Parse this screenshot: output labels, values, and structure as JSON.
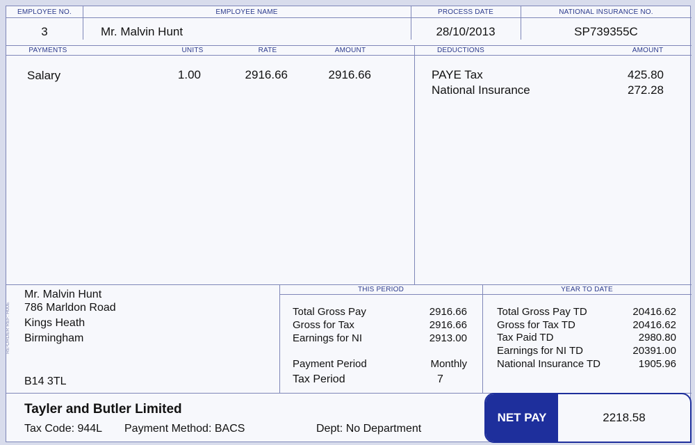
{
  "headers": {
    "employee_no": "EMPLOYEE No.",
    "employee_name": "EMPLOYEE NAME",
    "process_date": "PROCESS DATE",
    "ni_number": "NATIONAL INSURANCE No.",
    "payments": "PAYMENTS",
    "units": "UNITS",
    "rate": "RATE",
    "amount": "AMOUNT",
    "deductions": "DEDUCTIONS",
    "deductions_amount": "AMOUNT",
    "this_period": "THIS PERIOD",
    "year_to_date": "YEAR TO DATE"
  },
  "employee": {
    "number": "3",
    "name": "Mr. Malvin Hunt",
    "process_date": "28/10/2013",
    "ni_number": "SP739355C"
  },
  "payments": [
    {
      "label": "Salary",
      "units": "1.00",
      "rate": "2916.66",
      "amount": "2916.66"
    }
  ],
  "deductions": [
    {
      "label": "PAYE Tax",
      "amount": "425.80"
    },
    {
      "label": "National Insurance",
      "amount": "272.28"
    }
  ],
  "address": {
    "line1": "Mr. Malvin Hunt",
    "line2": "786 Marldon Road",
    "line3": "Kings Heath",
    "line4": "Birmingham",
    "postcode": "B14 3TL"
  },
  "this_period": {
    "rows": [
      {
        "label": "Total Gross Pay",
        "value": "2916.66"
      },
      {
        "label": "Gross for Tax",
        "value": "2916.66"
      },
      {
        "label": "Earnings for NI",
        "value": "2913.00"
      }
    ],
    "payment_period_label": "Payment Period",
    "payment_period_value": "Monthly",
    "tax_period_label": "Tax Period",
    "tax_period_value": "7"
  },
  "year_to_date": {
    "rows": [
      {
        "label": "Total Gross Pay TD",
        "value": "20416.62"
      },
      {
        "label": "Gross for Tax TD",
        "value": "20416.62"
      },
      {
        "label": "Tax Paid TD",
        "value": "2980.80"
      },
      {
        "label": "Earnings for NI TD",
        "value": "20391.00"
      },
      {
        "label": "National Insurance TD",
        "value": "1905.96"
      }
    ]
  },
  "footer": {
    "company": "Tayler and Butler Limited",
    "tax_code": "Tax Code: 944L",
    "payment_method": "Payment Method: BACS",
    "department": "Dept: No Department"
  },
  "net_pay": {
    "label": "NET PAY",
    "value": "2218.58"
  },
  "side_text": "RE-ORDER REF: H00E",
  "colors": {
    "accent": "#1e2f9c",
    "rule": "#7e86b8",
    "paper": "#f7f8fc"
  }
}
